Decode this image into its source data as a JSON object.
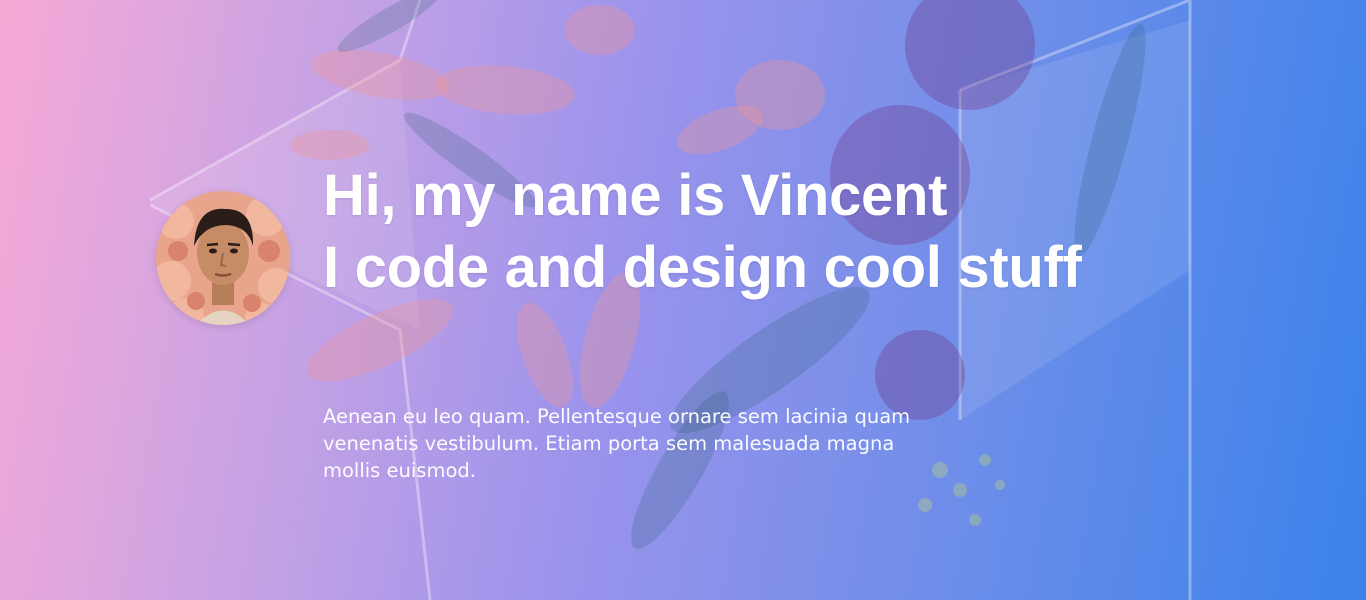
{
  "hero": {
    "headline_line1": "Hi, my name is Vincent",
    "headline_line2": "I code and design cool stuff",
    "intro": "Aenean eu leo quam. Pellentesque ornare sem lacinia quam venenatis vestibulum. Etiam porta sem malesuada magna mollis euismod."
  },
  "avatar": {
    "icon": "profile-photo"
  },
  "background": {
    "icon": "floral-photo",
    "gradient_start": "#f6a9d6",
    "gradient_end": "#3a82ea"
  }
}
